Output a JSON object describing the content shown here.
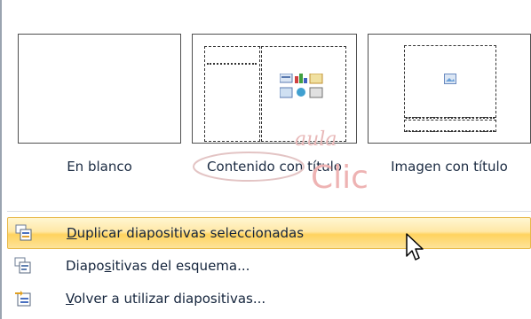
{
  "layouts": [
    {
      "caption": "En blanco"
    },
    {
      "caption": "Contenido con título"
    },
    {
      "caption": "Imagen con título"
    }
  ],
  "watermark": {
    "line1": "aula",
    "line2": "Clic"
  },
  "menu": {
    "items": [
      {
        "before": "",
        "accel": "D",
        "after": "uplicar diapositivas seleccionadas",
        "icon": "duplicate-slides-icon",
        "highlighted": true
      },
      {
        "before": "Diapo",
        "accel": "s",
        "after": "itivas del esquema...",
        "icon": "outline-slides-icon",
        "highlighted": false
      },
      {
        "before": "",
        "accel": "V",
        "after": "olver a utilizar diapositivas...",
        "icon": "reuse-slides-icon",
        "highlighted": false
      }
    ]
  },
  "colors": {
    "highlight": "#ffd35e",
    "text": "#1a2a40",
    "watermark": "#e3a3a3"
  }
}
